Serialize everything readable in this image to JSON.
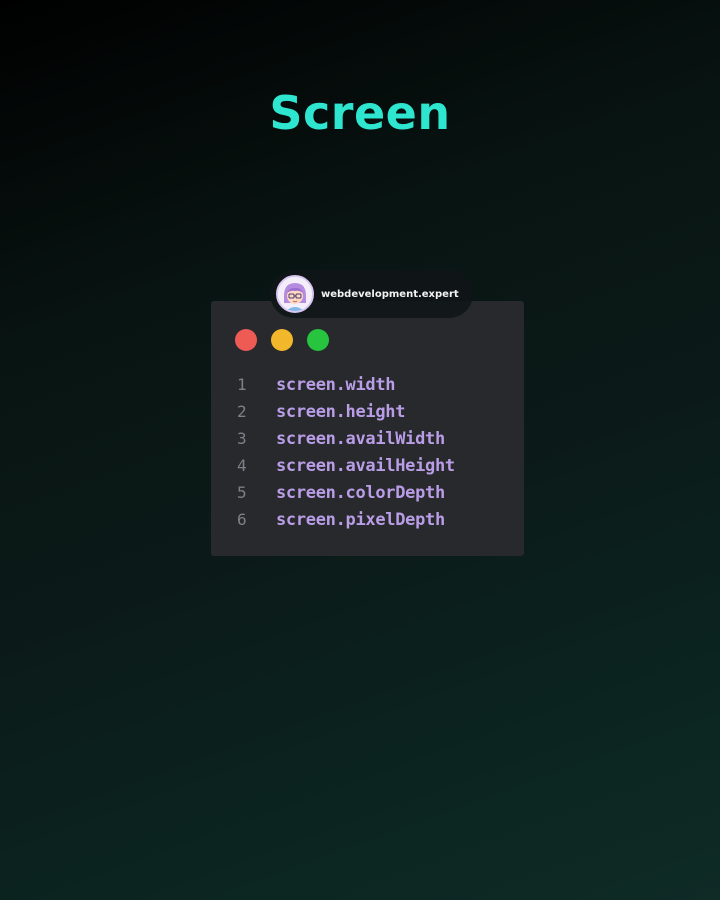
{
  "title": "Screen",
  "author": {
    "handle": "webdevelopment.expert"
  },
  "window": {
    "buttons": [
      {
        "name": "close",
        "color": "#ee5b55"
      },
      {
        "name": "minimize",
        "color": "#f2b72a"
      },
      {
        "name": "maximize",
        "color": "#27c43f"
      }
    ]
  },
  "code": {
    "lines": [
      {
        "number": "1",
        "text": "screen.width"
      },
      {
        "number": "2",
        "text": "screen.height"
      },
      {
        "number": "3",
        "text": "screen.availWidth"
      },
      {
        "number": "4",
        "text": "screen.availHeight"
      },
      {
        "number": "5",
        "text": "screen.colorDepth"
      },
      {
        "number": "6",
        "text": "screen.pixelDepth"
      }
    ]
  },
  "colors": {
    "title": "#2ee6cf",
    "code_text": "#b99de6",
    "line_number": "#7d8088",
    "window_bg": "#27292c"
  }
}
